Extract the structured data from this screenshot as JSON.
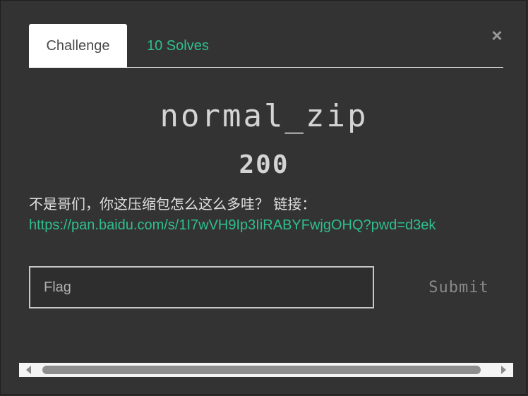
{
  "modal": {
    "close_glyph": "×",
    "tabs": [
      {
        "label": "Challenge",
        "active": true
      },
      {
        "label": "10 Solves",
        "active": false
      }
    ],
    "challenge": {
      "name": "normal_zip",
      "points": "200",
      "description": "不是哥们，你这压缩包怎么这么多哇？ 链接：",
      "link": "https://pan.baidu.com/s/1I7wVH9Ip3IiRABYFwjgOHQ?pwd=d3ek"
    },
    "flag_input": {
      "placeholder": "Flag",
      "value": ""
    },
    "submit_label": "Submit"
  },
  "colors": {
    "background": "#333333",
    "accent": "#2fbf8f",
    "title_text": "#d4d4d4",
    "submit_text": "#8a8a8a",
    "active_tab_bg": "#ffffff"
  },
  "icons": {
    "close": "close-icon",
    "scroll_left": "scroll-left-arrow-icon",
    "scroll_right": "scroll-right-arrow-icon"
  }
}
